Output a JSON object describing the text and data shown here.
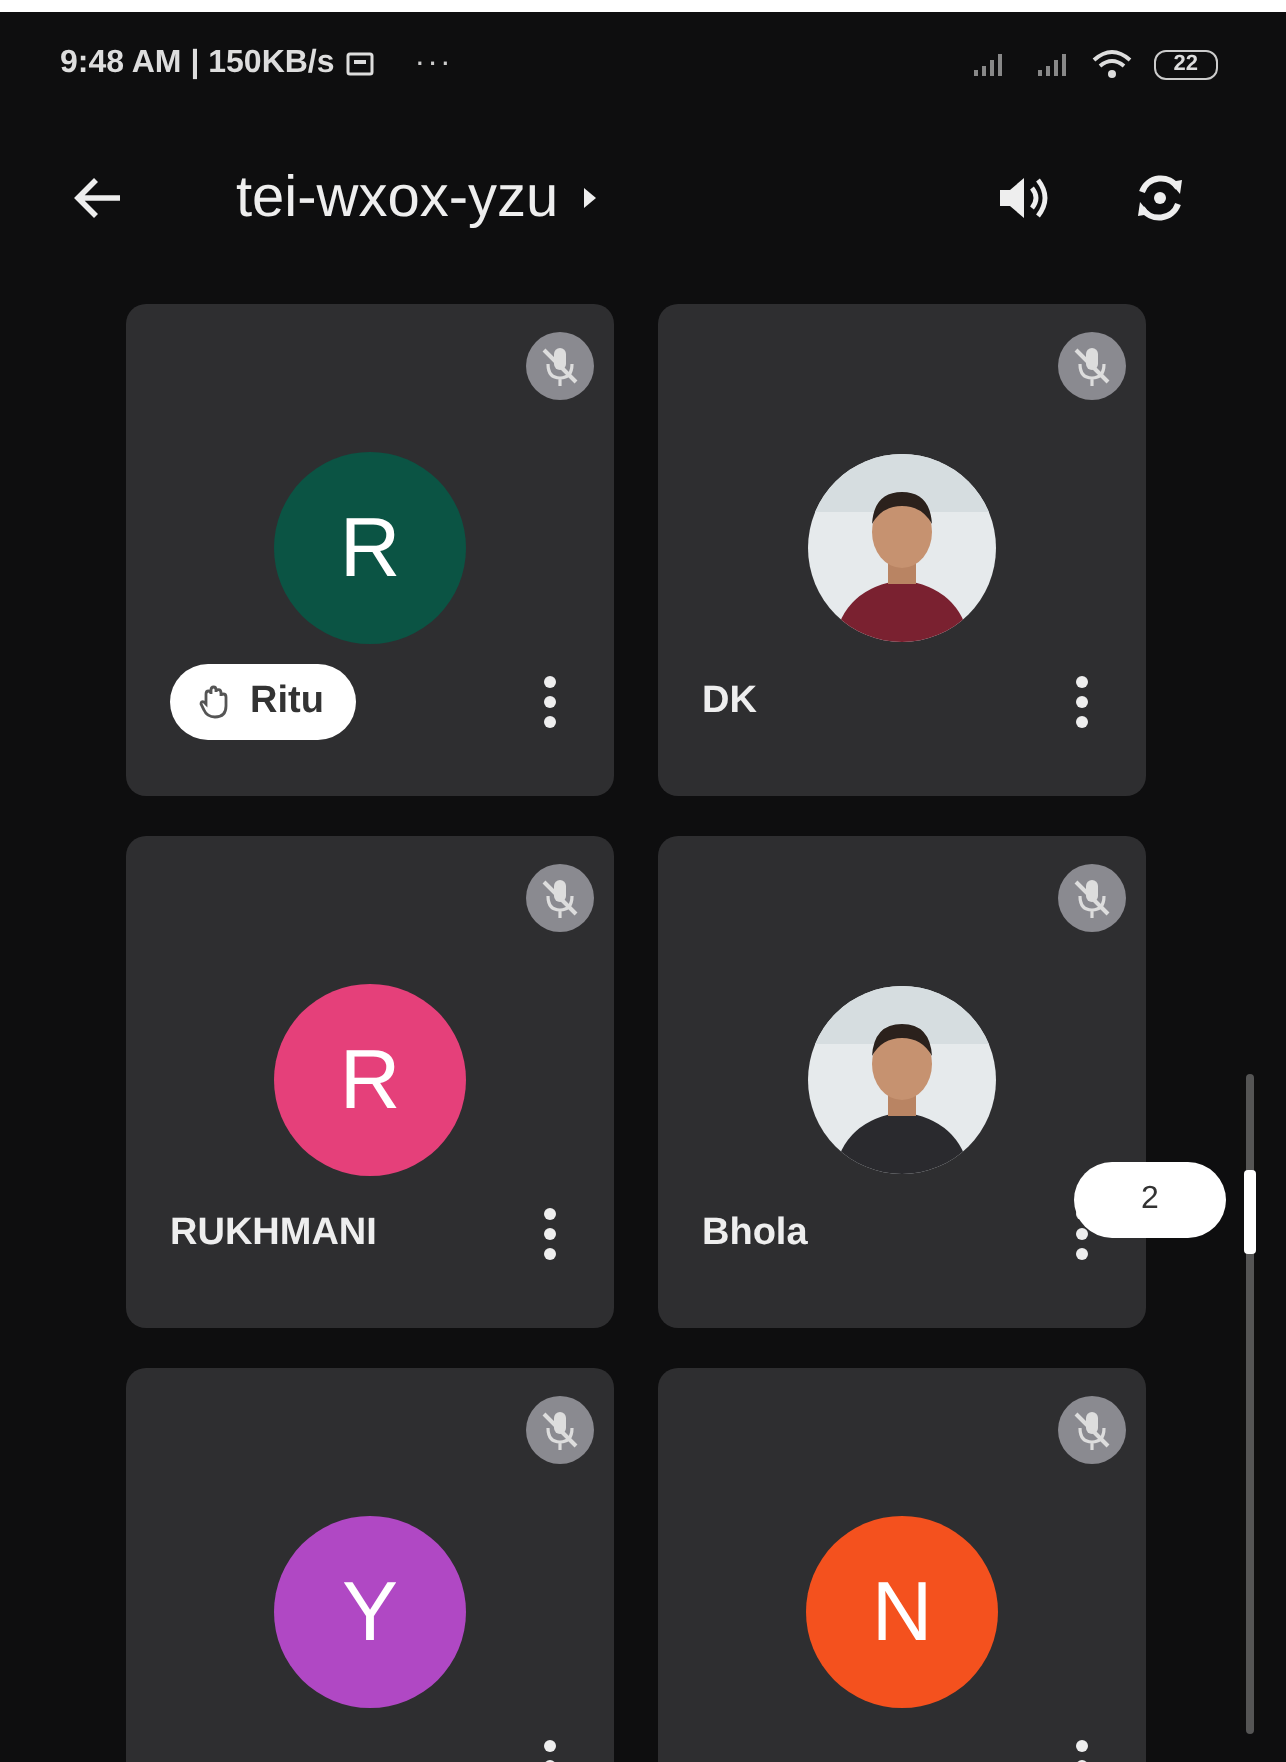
{
  "status_bar": {
    "time": "9:48 AM | 150KB/s",
    "more": "···",
    "battery": "22"
  },
  "header": {
    "title": "tei-wxox-yzu"
  },
  "tiles": [
    {
      "name": "Ritu",
      "initial": "R",
      "kind": "initial",
      "color": "#0b5444",
      "muted": true,
      "hand_raised": true
    },
    {
      "name": "DK",
      "color": "#7a2130",
      "muted": true,
      "hand_raised": false
    },
    {
      "name": "RUKHMANI",
      "initial": "R",
      "kind": "initial",
      "color": "#e5407a",
      "muted": true,
      "hand_raised": false
    },
    {
      "name": "Bhola",
      "color": "#2a2a2e",
      "muted": true,
      "hand_raised": false
    },
    {
      "initial": "Y",
      "kind": "initial",
      "color": "#b048c4",
      "muted": true
    },
    {
      "initial": "N",
      "kind": "initial",
      "color": "#f4511e",
      "muted": true
    }
  ],
  "page_indicator": "2"
}
